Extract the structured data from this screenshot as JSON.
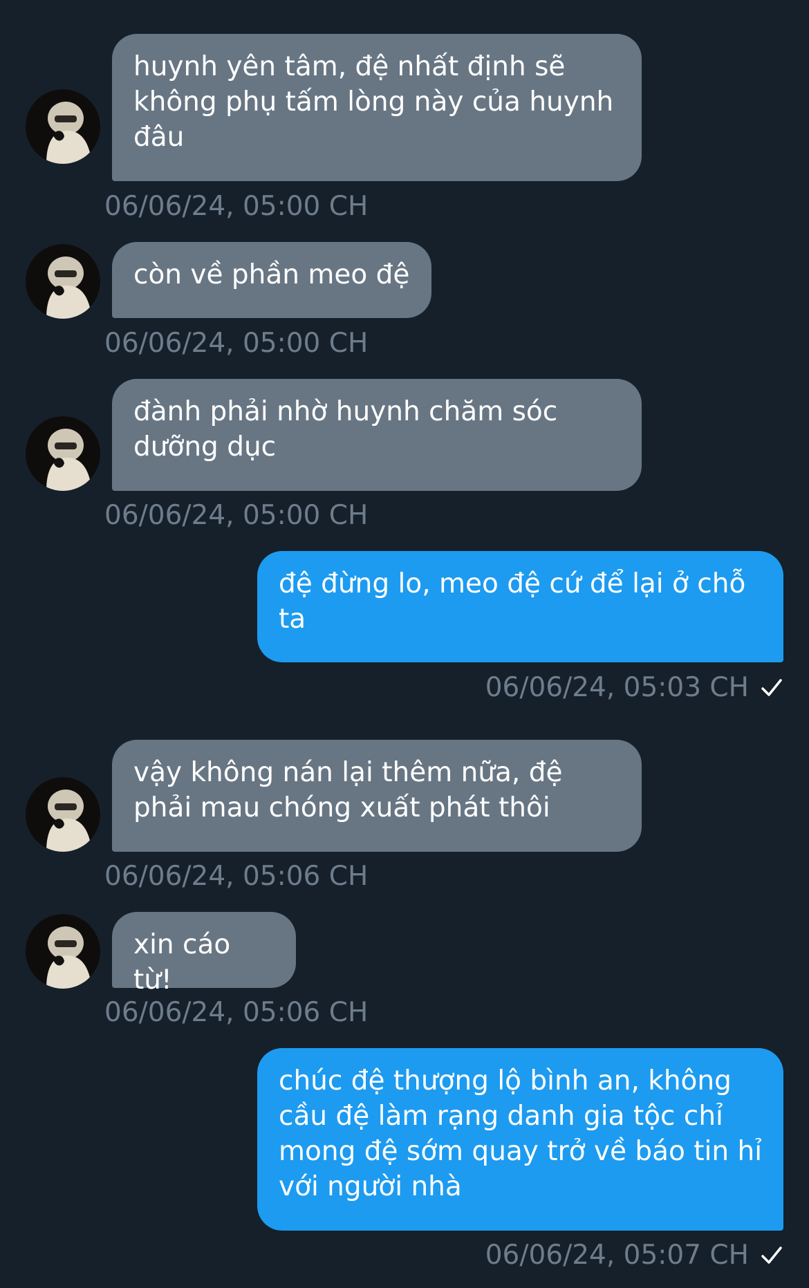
{
  "messages": [
    {
      "direction": "in",
      "text": "huynh yên tâm, đệ nhất định sẽ\nkhông phụ tấm lòng này của huynh\nđâu",
      "time": "06/06/24, 05:00 CH"
    },
    {
      "direction": "in",
      "text": "còn về phần meo đệ",
      "time": "06/06/24, 05:00 CH"
    },
    {
      "direction": "in",
      "text": "đành phải nhờ huynh chăm sóc\ndưỡng dục",
      "time": "06/06/24, 05:00 CH"
    },
    {
      "direction": "out",
      "text": "đệ đừng lo, meo đệ cứ để lại ở chỗ\nta",
      "time": "06/06/24, 05:03 CH",
      "status": "sent-check-icon"
    },
    {
      "direction": "in",
      "text": "vậy không nán lại thêm nữa, đệ\nphải mau chóng xuất phát thôi",
      "time": "06/06/24, 05:06 CH"
    },
    {
      "direction": "in",
      "text": "xin cáo từ!",
      "time": "06/06/24, 05:06 CH"
    },
    {
      "direction": "out",
      "text": "chúc đệ thượng lộ bình an, không\ncầu đệ làm rạng danh gia tộc chỉ\nmong đệ sớm quay trở về báo tin hỉ\nvới người nhà",
      "time": "06/06/24, 05:07 CH",
      "status": "sent-check-icon"
    }
  ],
  "colors": {
    "background": "#15202b",
    "incoming_bubble": "#687684",
    "outgoing_bubble": "#1d9bf0",
    "timestamp": "#6e7d8c",
    "text": "#ffffff"
  }
}
